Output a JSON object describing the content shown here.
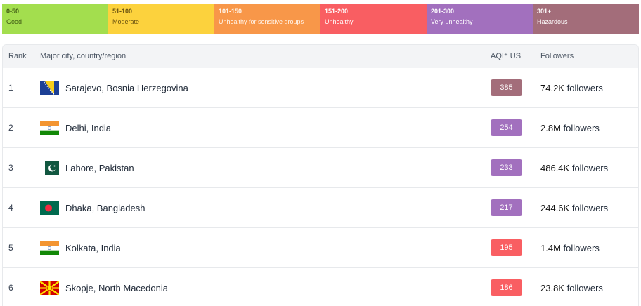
{
  "legend": [
    {
      "range": "0-50",
      "label": "Good",
      "color": "#a3de4e"
    },
    {
      "range": "51-100",
      "label": "Moderate",
      "color": "#fcd23d"
    },
    {
      "range": "101-150",
      "label": "Unhealthy for sensitive groups",
      "color": "#f89749"
    },
    {
      "range": "151-200",
      "label": "Unhealthy",
      "color": "#f95e62"
    },
    {
      "range": "201-300",
      "label": "Very unhealthy",
      "color": "#a270be"
    },
    {
      "range": "301+",
      "label": "Hazardous",
      "color": "#a36d7a"
    }
  ],
  "table": {
    "headers": {
      "rank": "Rank",
      "city": "Major city, country/region",
      "aqi": "AQI⁺ US",
      "followers": "Followers"
    },
    "rows": [
      {
        "rank": "1",
        "city": "Sarajevo, Bosnia Herzegovina",
        "flag": "bosnia-flag-icon",
        "aqi": "385",
        "aqi_color": "#a36d7a",
        "followers_count": "74.2K",
        "followers_word": "followers"
      },
      {
        "rank": "2",
        "city": "Delhi, India",
        "flag": "india-flag-icon",
        "aqi": "254",
        "aqi_color": "#a270be",
        "followers_count": "2.8M",
        "followers_word": "followers"
      },
      {
        "rank": "3",
        "city": "Lahore, Pakistan",
        "flag": "pakistan-flag-icon",
        "aqi": "233",
        "aqi_color": "#a270be",
        "followers_count": "486.4K",
        "followers_word": "followers"
      },
      {
        "rank": "4",
        "city": "Dhaka, Bangladesh",
        "flag": "bangladesh-flag-icon",
        "aqi": "217",
        "aqi_color": "#a270be",
        "followers_count": "244.6K",
        "followers_word": "followers"
      },
      {
        "rank": "5",
        "city": "Kolkata, India",
        "flag": "india-flag-icon",
        "aqi": "195",
        "aqi_color": "#f95e62",
        "followers_count": "1.4M",
        "followers_word": "followers"
      },
      {
        "rank": "6",
        "city": "Skopje, North Macedonia",
        "flag": "macedonia-flag-icon",
        "aqi": "186",
        "aqi_color": "#f95e62",
        "followers_count": "23.8K",
        "followers_word": "followers"
      }
    ]
  }
}
